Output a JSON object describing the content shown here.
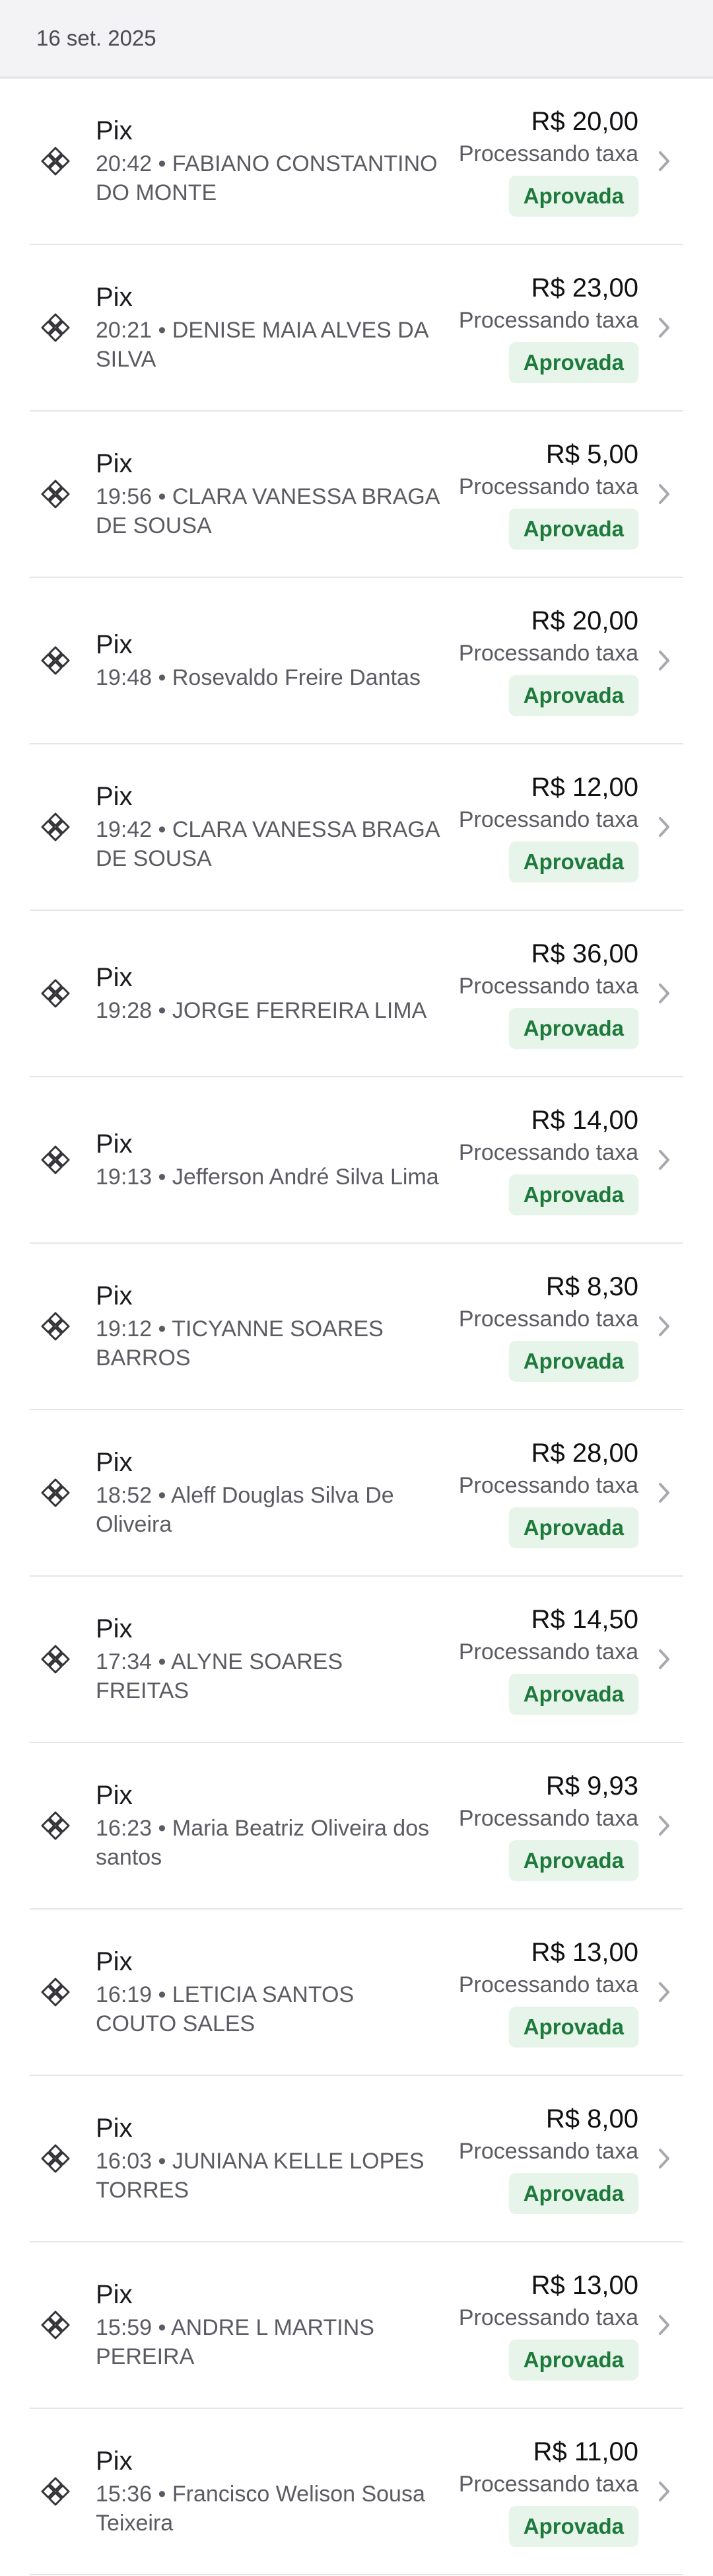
{
  "date_header": "16 set. 2025",
  "colors": {
    "badge_bg": "#e6f4ea",
    "badge_text": "#1e7a3b",
    "icon": "#333338",
    "chevron": "#a8a8ae"
  },
  "icons": {
    "payment": "pix-icon",
    "chevron": "chevron-right-icon"
  },
  "transactions": [
    {
      "method": "Pix",
      "detail": "20:42 • FABIANO CONSTANTINO DO MONTE",
      "amount": "R$ 20,00",
      "status_text": "Processando taxa",
      "badge": "Aprovada"
    },
    {
      "method": "Pix",
      "detail": "20:21 • DENISE MAIA ALVES DA SILVA",
      "amount": "R$ 23,00",
      "status_text": "Processando taxa",
      "badge": "Aprovada"
    },
    {
      "method": "Pix",
      "detail": "19:56 • CLARA VANESSA BRAGA DE SOUSA",
      "amount": "R$ 5,00",
      "status_text": "Processando taxa",
      "badge": "Aprovada"
    },
    {
      "method": "Pix",
      "detail": "19:48 • Rosevaldo Freire Dantas",
      "amount": "R$ 20,00",
      "status_text": "Processando taxa",
      "badge": "Aprovada"
    },
    {
      "method": "Pix",
      "detail": "19:42 • CLARA VANESSA BRAGA DE SOUSA",
      "amount": "R$ 12,00",
      "status_text": "Processando taxa",
      "badge": "Aprovada"
    },
    {
      "method": "Pix",
      "detail": "19:28 • JORGE FERREIRA LIMA",
      "amount": "R$ 36,00",
      "status_text": "Processando taxa",
      "badge": "Aprovada"
    },
    {
      "method": "Pix",
      "detail": "19:13 • Jefferson André Silva Lima",
      "amount": "R$ 14,00",
      "status_text": "Processando taxa",
      "badge": "Aprovada"
    },
    {
      "method": "Pix",
      "detail": "19:12 • TICYANNE SOARES BARROS",
      "amount": "R$ 8,30",
      "status_text": "Processando taxa",
      "badge": "Aprovada"
    },
    {
      "method": "Pix",
      "detail": "18:52 • Aleff Douglas Silva De Oliveira",
      "amount": "R$ 28,00",
      "status_text": "Processando taxa",
      "badge": "Aprovada"
    },
    {
      "method": "Pix",
      "detail": "17:34 • ALYNE SOARES FREITAS",
      "amount": "R$ 14,50",
      "status_text": "Processando taxa",
      "badge": "Aprovada"
    },
    {
      "method": "Pix",
      "detail": "16:23 • Maria Beatriz Oliveira dos santos",
      "amount": "R$ 9,93",
      "status_text": "Processando taxa",
      "badge": "Aprovada"
    },
    {
      "method": "Pix",
      "detail": "16:19 • LETICIA SANTOS COUTO SALES",
      "amount": "R$ 13,00",
      "status_text": "Processando taxa",
      "badge": "Aprovada"
    },
    {
      "method": "Pix",
      "detail": "16:03 • JUNIANA KELLE LOPES TORRES",
      "amount": "R$ 8,00",
      "status_text": "Processando taxa",
      "badge": "Aprovada"
    },
    {
      "method": "Pix",
      "detail": "15:59 • ANDRE L MARTINS PEREIRA",
      "amount": "R$ 13,00",
      "status_text": "Processando taxa",
      "badge": "Aprovada"
    },
    {
      "method": "Pix",
      "detail": "15:36 • Francisco Welison Sousa Teixeira",
      "amount": "R$ 11,00",
      "status_text": "Processando taxa",
      "badge": "Aprovada"
    }
  ]
}
